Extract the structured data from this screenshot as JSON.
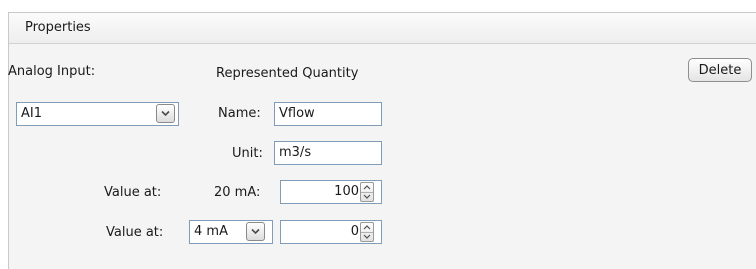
{
  "panel": {
    "title": "Properties"
  },
  "delete_label": "Delete",
  "analog_input": {
    "label": "Analog Input:",
    "selected": "AI1"
  },
  "represented_quantity": {
    "heading": "Represented Quantity",
    "name_label": "Name:",
    "name_value": "Vflow",
    "unit_label": "Unit:",
    "unit_value": "m3/s"
  },
  "value_row_1": {
    "label": "Value at:",
    "current_label": "20 mA:",
    "value": "100"
  },
  "value_row_2": {
    "label": "Value at:",
    "current_selected": "4 mA",
    "value": "0"
  },
  "icons": {
    "dropdown": "chevron-down-icon",
    "spinner_up": "caret-up-icon",
    "spinner_down": "caret-down-icon"
  }
}
